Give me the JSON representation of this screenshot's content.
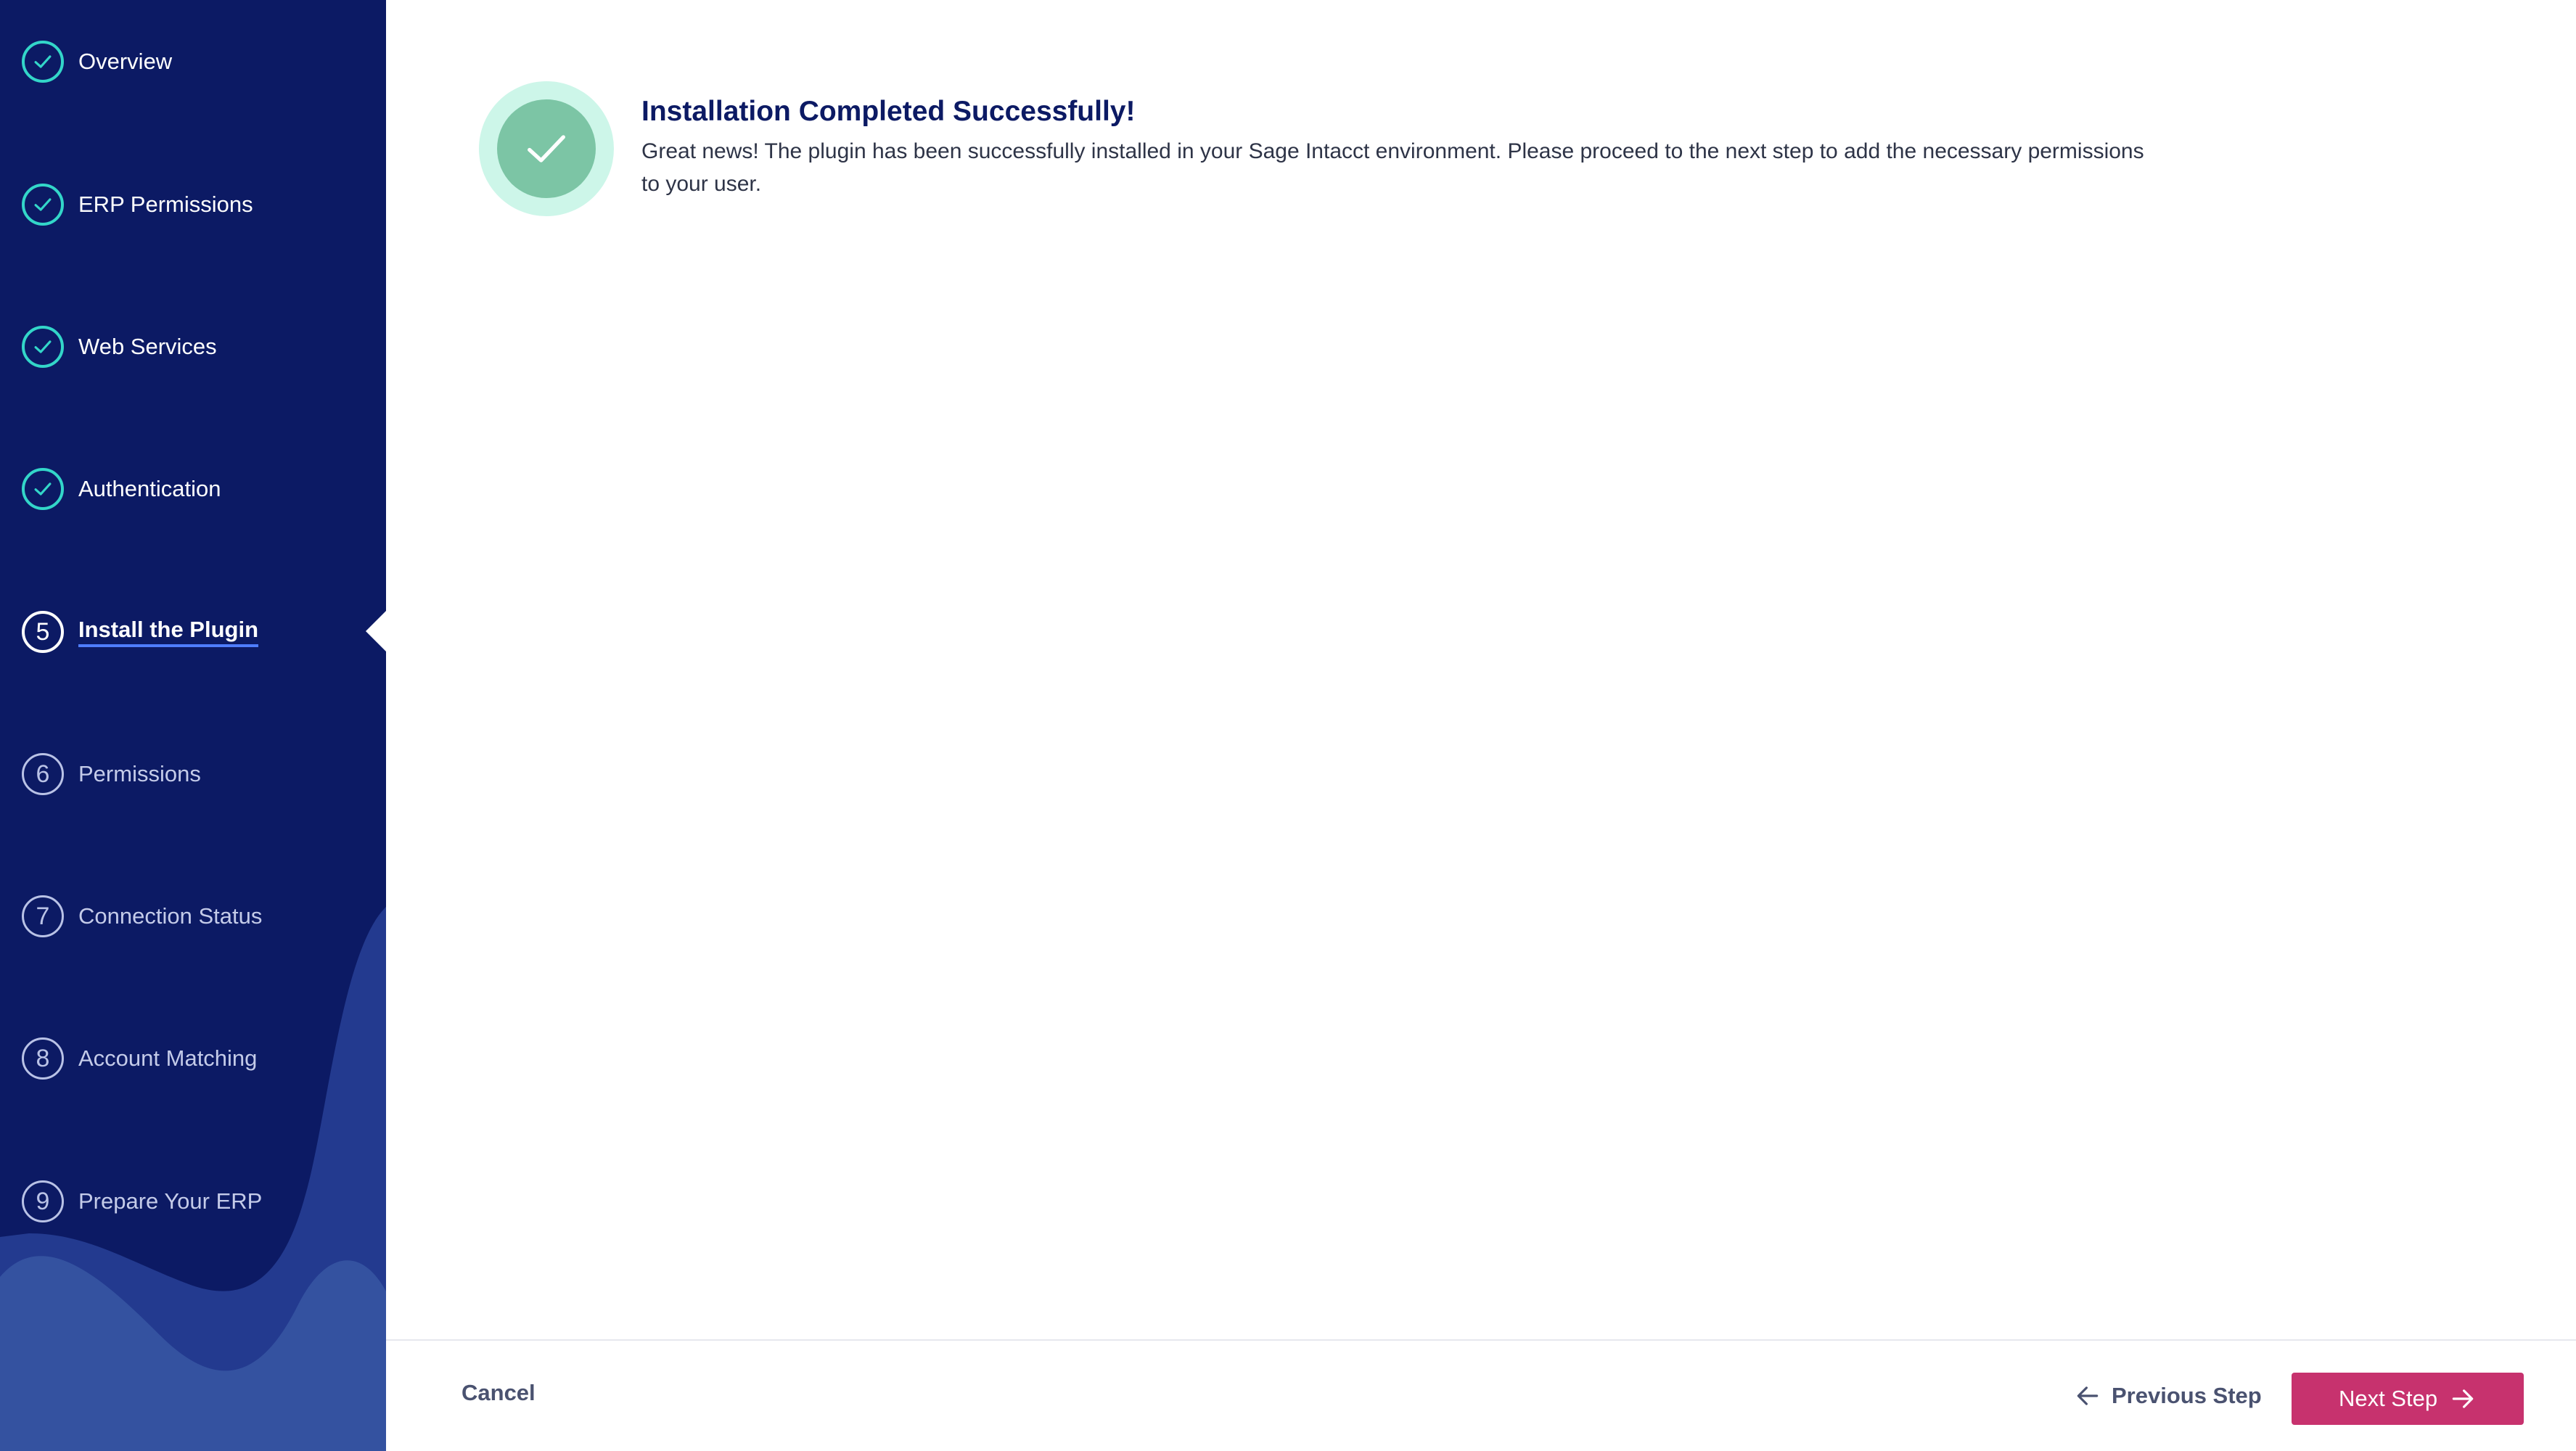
{
  "sidebar": {
    "steps": [
      {
        "marker": "",
        "label": "Overview",
        "state": "done"
      },
      {
        "marker": "",
        "label": "ERP Permissions",
        "state": "done"
      },
      {
        "marker": "",
        "label": "Web Services",
        "state": "done"
      },
      {
        "marker": "",
        "label": "Authentication",
        "state": "done"
      },
      {
        "marker": "5",
        "label": "Install the Plugin",
        "state": "current"
      },
      {
        "marker": "6",
        "label": "Permissions",
        "state": "todo"
      },
      {
        "marker": "7",
        "label": "Connection Status",
        "state": "todo"
      },
      {
        "marker": "8",
        "label": "Account Matching",
        "state": "todo"
      },
      {
        "marker": "9",
        "label": "Prepare Your ERP",
        "state": "todo"
      }
    ]
  },
  "main": {
    "badge_icon": "check-icon",
    "title": "Installation Completed Successfully!",
    "body": "Great news! The plugin has been successfully installed in your Sage Intacct environment. Please proceed to the next step to add the necessary permissions to your user."
  },
  "footer": {
    "cancel_label": "Cancel",
    "previous_label": "Previous Step",
    "next_label": "Next Step"
  },
  "colors": {
    "sidebar_bg": "#0c1a64",
    "done_accent": "#33d6c9",
    "primary_button": "#c7326e",
    "success_outer": "#cdf6e9",
    "success_inner": "#7cc5a5"
  }
}
